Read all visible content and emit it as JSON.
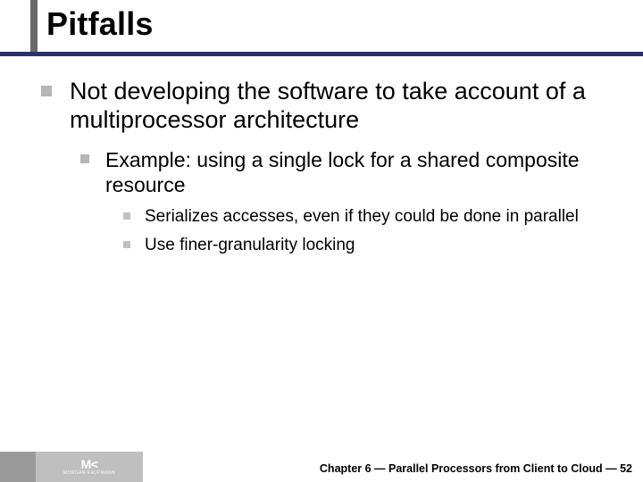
{
  "title": "Pitfalls",
  "bullets": {
    "l1": "Not developing the software to take account of a multiprocessor architecture",
    "l2": "Example: using a single lock for a shared composite resource",
    "l3a": "Serializes accesses, even if they could be done in parallel",
    "l3b": "Use finer-granularity locking"
  },
  "footer": {
    "logo_main": "M<",
    "logo_sub": "MORGAN KAUFMANN",
    "chapter_line": "Chapter 6 — Parallel Processors from Client to Cloud — 52"
  }
}
